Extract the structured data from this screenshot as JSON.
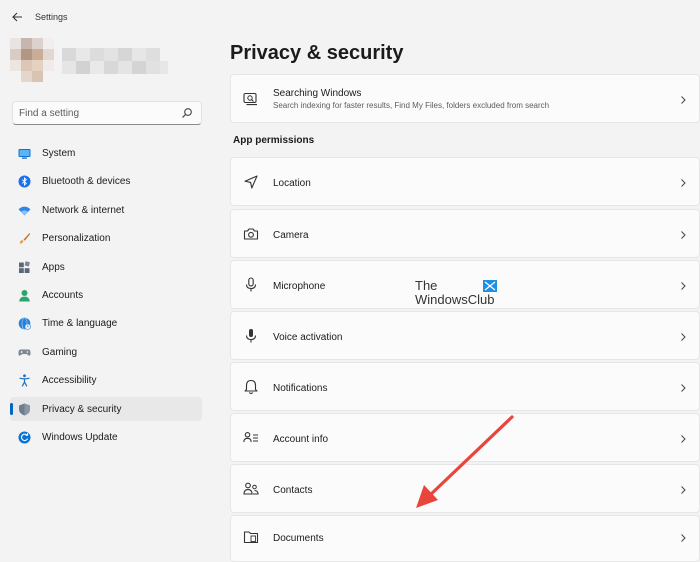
{
  "window": {
    "title": "Settings"
  },
  "search": {
    "placeholder": "Find a setting"
  },
  "sidebar": {
    "items": [
      {
        "label": "System",
        "icon": "monitor-icon"
      },
      {
        "label": "Bluetooth & devices",
        "icon": "bluetooth-icon"
      },
      {
        "label": "Network & internet",
        "icon": "wifi-icon"
      },
      {
        "label": "Personalization",
        "icon": "brush-icon"
      },
      {
        "label": "Apps",
        "icon": "apps-icon"
      },
      {
        "label": "Accounts",
        "icon": "person-icon"
      },
      {
        "label": "Time & language",
        "icon": "globe-clock-icon"
      },
      {
        "label": "Gaming",
        "icon": "gamepad-icon"
      },
      {
        "label": "Accessibility",
        "icon": "accessibility-icon"
      },
      {
        "label": "Privacy & security",
        "icon": "shield-icon",
        "active": true
      },
      {
        "label": "Windows Update",
        "icon": "update-icon"
      }
    ]
  },
  "main": {
    "title": "Privacy & security",
    "top_card": {
      "label": "Searching Windows",
      "sub": "Search indexing for faster results, Find My Files, folders excluded from search"
    },
    "section_title": "App permissions",
    "permissions": [
      {
        "label": "Location",
        "icon": "location-icon"
      },
      {
        "label": "Camera",
        "icon": "camera-icon"
      },
      {
        "label": "Microphone",
        "icon": "microphone-icon"
      },
      {
        "label": "Voice activation",
        "icon": "voice-icon"
      },
      {
        "label": "Notifications",
        "icon": "bell-icon"
      },
      {
        "label": "Account info",
        "icon": "account-info-icon"
      },
      {
        "label": "Contacts",
        "icon": "contacts-icon"
      },
      {
        "label": "Documents",
        "icon": "documents-icon"
      }
    ]
  },
  "watermark": {
    "line1": "The",
    "line2": "WindowsClub"
  },
  "colors": {
    "accent": "#0067c0",
    "arrow": "#e8453c",
    "background": "#f3f3f3",
    "card": "#fbfbfb"
  }
}
